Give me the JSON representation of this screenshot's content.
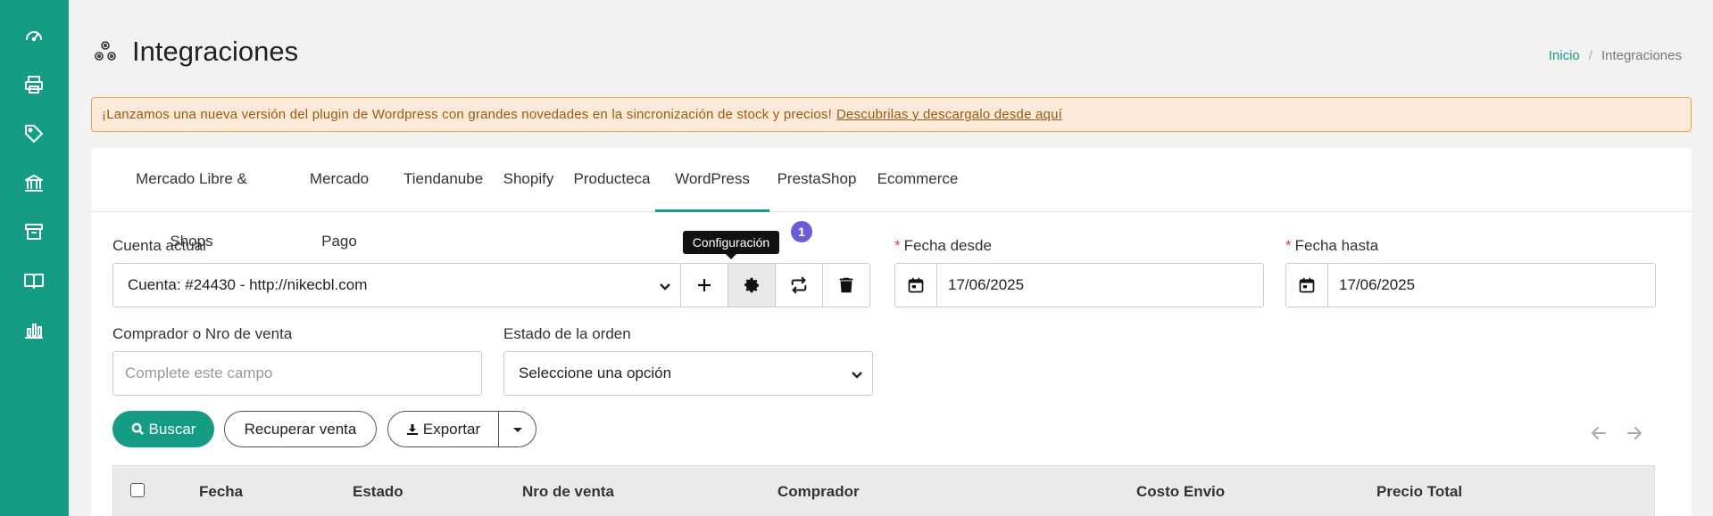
{
  "sidebar": {
    "items": [
      {
        "icon": "dashboard-icon"
      },
      {
        "icon": "printer-icon"
      },
      {
        "icon": "tag-icon"
      },
      {
        "icon": "bank-icon"
      },
      {
        "icon": "box-icon"
      },
      {
        "icon": "book-icon"
      },
      {
        "icon": "bar-chart-icon"
      }
    ]
  },
  "header": {
    "title": "Integraciones",
    "icon": "integrations-icon"
  },
  "breadcrumb": {
    "home": "Inicio",
    "separator": "/",
    "current": "Integraciones"
  },
  "alert": {
    "text": "¡Lanzamos una nueva versión del plugin de Wordpress con grandes novedades en la sincronización de stock y precios!",
    "link": "Descubrilas y descargalo desde aquí"
  },
  "tabs": [
    {
      "label": "Mercado Libre & Shops"
    },
    {
      "label": "Mercado Pago"
    },
    {
      "label": "Tiendanube"
    },
    {
      "label": "Shopify"
    },
    {
      "label": "Producteca"
    },
    {
      "label": "WordPress",
      "active": true
    },
    {
      "label": "PrestaShop"
    },
    {
      "label": "Ecommerce"
    }
  ],
  "account": {
    "label": "Cuenta actual",
    "value": "Cuenta: #24430 - http://nikecbl.com",
    "tooltip": "Configuración",
    "badge": "1"
  },
  "date_from": {
    "required_mark": "*",
    "label": "Fecha desde",
    "value": "17/06/2025"
  },
  "date_to": {
    "required_mark": "*",
    "label": "Fecha hasta",
    "value": "17/06/2025"
  },
  "buyer": {
    "label": "Comprador o Nro de venta",
    "placeholder": "Complete este campo"
  },
  "order_state": {
    "label": "Estado de la orden",
    "value": "Seleccione una opción"
  },
  "actions": {
    "search": "Buscar",
    "recover": "Recuperar venta",
    "export": "Exportar"
  },
  "table": {
    "columns": [
      "Fecha",
      "Estado",
      "Nro de venta",
      "Comprador",
      "Costo Envio",
      "Precio Total"
    ]
  },
  "colors": {
    "brand": "#159c85",
    "badge": "#6a5bd9",
    "alert_bg": "#fbe9d9",
    "alert_border": "#e9a54f"
  }
}
